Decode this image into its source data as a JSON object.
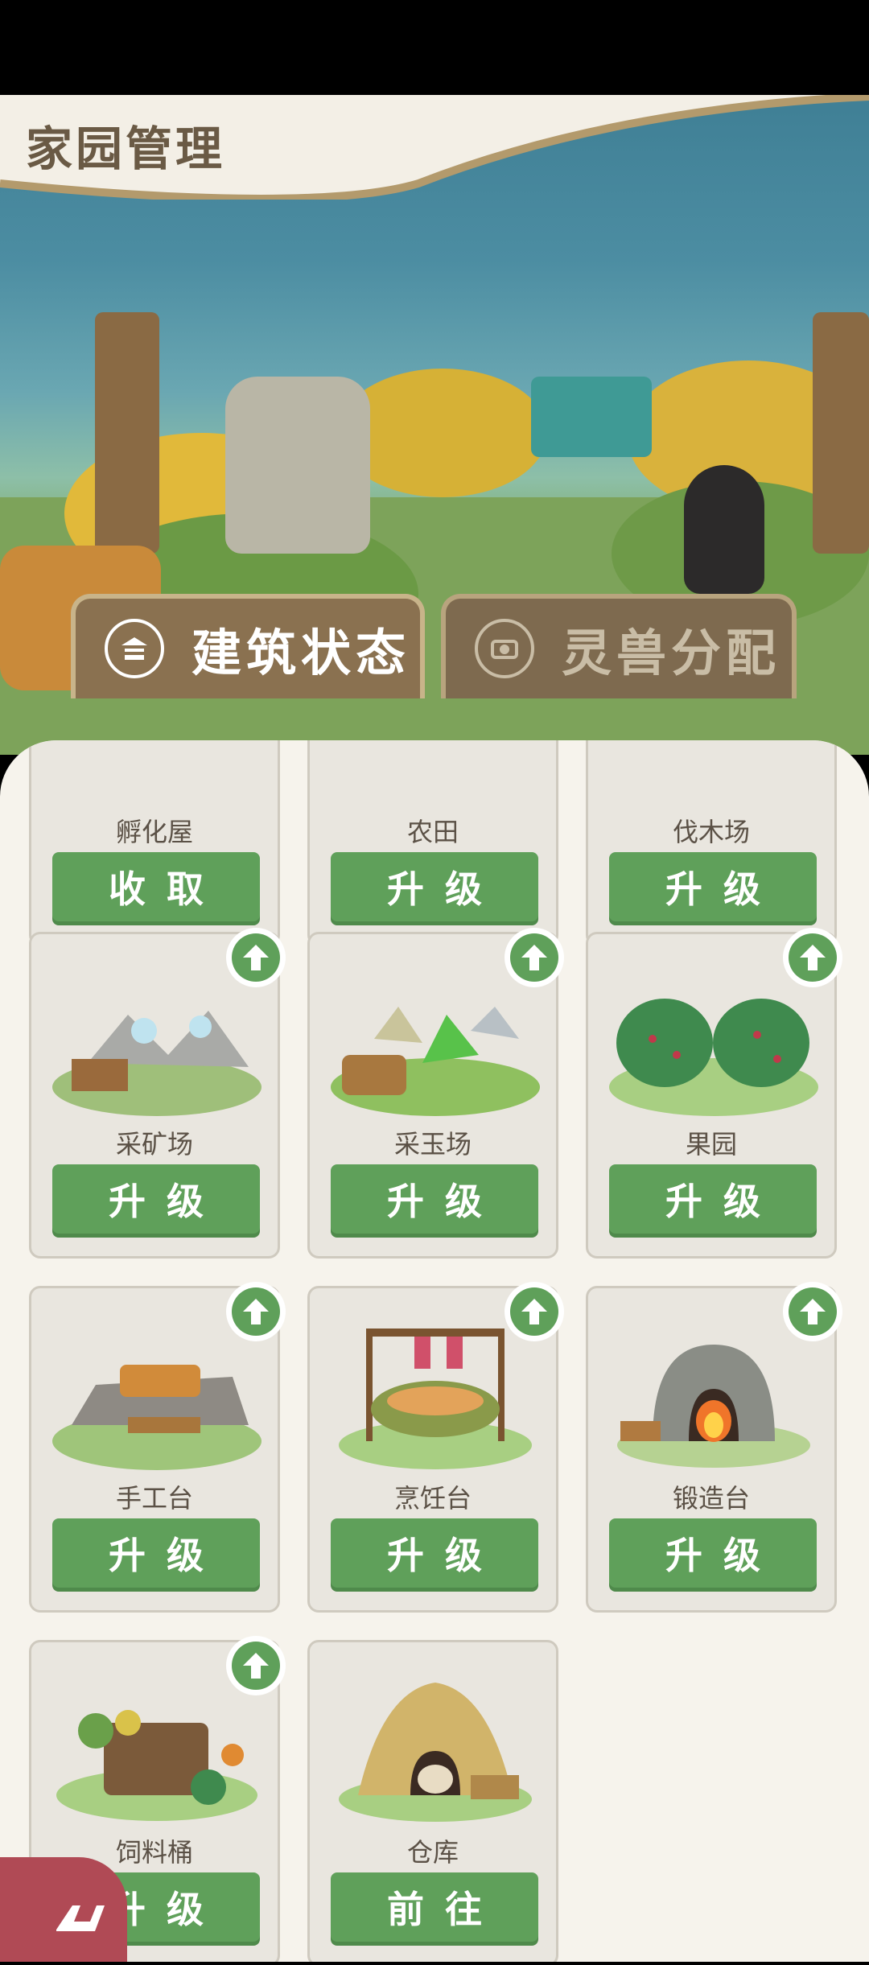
{
  "header": {
    "title": "家园管理"
  },
  "tabs": [
    {
      "label": "建筑状态",
      "icon": "building-icon",
      "active": true
    },
    {
      "label": "灵兽分配",
      "icon": "camera-icon",
      "active": false
    }
  ],
  "colors": {
    "accent_green": "#5fa05a",
    "tab_brown": "#8a7150",
    "panel_bg": "#f6f3ec"
  },
  "buildings": [
    {
      "name": "孵化屋",
      "action": "收取",
      "upgrade_available": false
    },
    {
      "name": "农田",
      "action": "升级",
      "upgrade_available": false
    },
    {
      "name": "伐木场",
      "action": "升级",
      "upgrade_available": false
    },
    {
      "name": "采矿场",
      "action": "升级",
      "upgrade_available": true
    },
    {
      "name": "采玉场",
      "action": "升级",
      "upgrade_available": true
    },
    {
      "name": "果园",
      "action": "升级",
      "upgrade_available": true
    },
    {
      "name": "手工台",
      "action": "升级",
      "upgrade_available": true
    },
    {
      "name": "烹饪台",
      "action": "升级",
      "upgrade_available": true
    },
    {
      "name": "锻造台",
      "action": "升级",
      "upgrade_available": true
    },
    {
      "name": "饲料桶",
      "action": "升级",
      "upgrade_available": true
    },
    {
      "name": "仓库",
      "action": "前往",
      "upgrade_available": false
    }
  ]
}
